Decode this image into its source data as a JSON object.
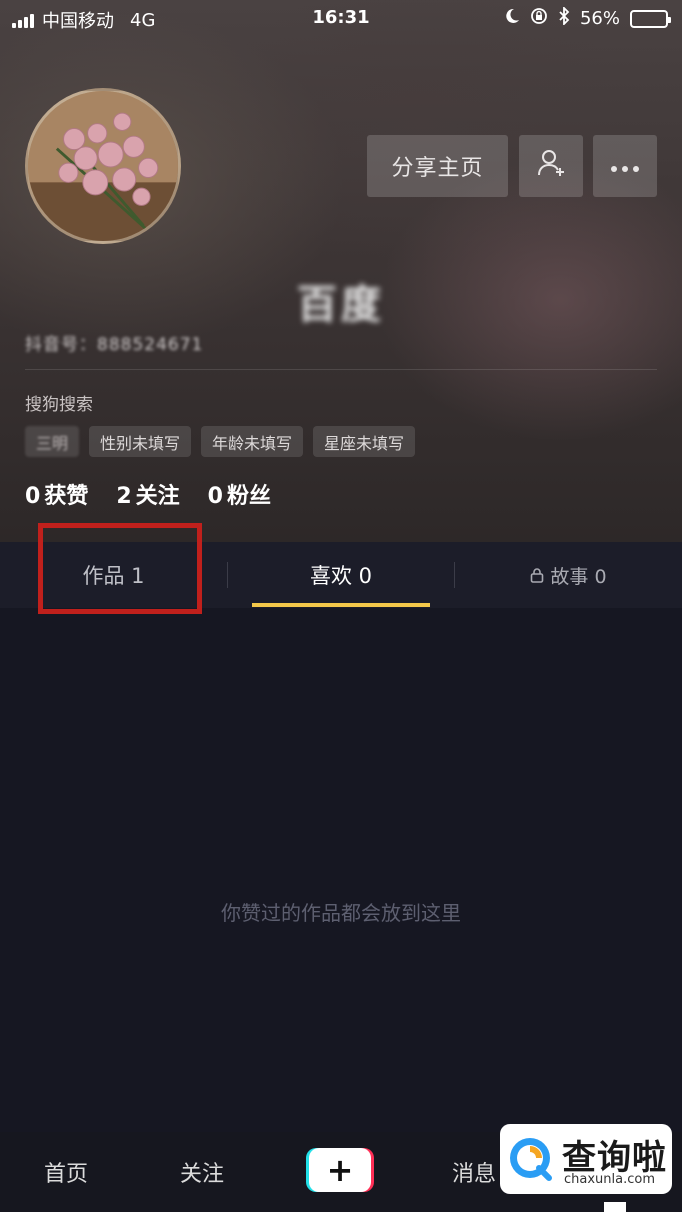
{
  "status_bar": {
    "carrier": "中国移动",
    "network": "4G",
    "time": "16:31",
    "battery": "56%",
    "battery_level": 0.56
  },
  "profile": {
    "share_button": "分享主页",
    "add_friend_icon": "add-user-icon",
    "more_icon": "more-icon",
    "nickname": "百度",
    "douyin_id": "抖音号：888524671",
    "signature": "搜狗搜索",
    "tags": [
      "三明",
      "性别未填写",
      "年龄未填写",
      "星座未填写"
    ],
    "stats": [
      {
        "value": "0",
        "label": "获赞"
      },
      {
        "value": "2",
        "label": "关注"
      },
      {
        "value": "0",
        "label": "粉丝"
      }
    ]
  },
  "tabs": {
    "works": "作品 1",
    "likes": "喜欢 0",
    "story": "故事 0",
    "active": "likes"
  },
  "empty_message": "你赞过的作品都会放到这里",
  "bottom_nav": {
    "home": "首页",
    "follow": "关注",
    "message": "消息"
  },
  "watermark": {
    "name": "查询啦",
    "url": "chaxunla.com"
  },
  "colors": {
    "accent_underline": "#f4c84a",
    "highlight_box": "#c0201c",
    "background": "#161722"
  }
}
